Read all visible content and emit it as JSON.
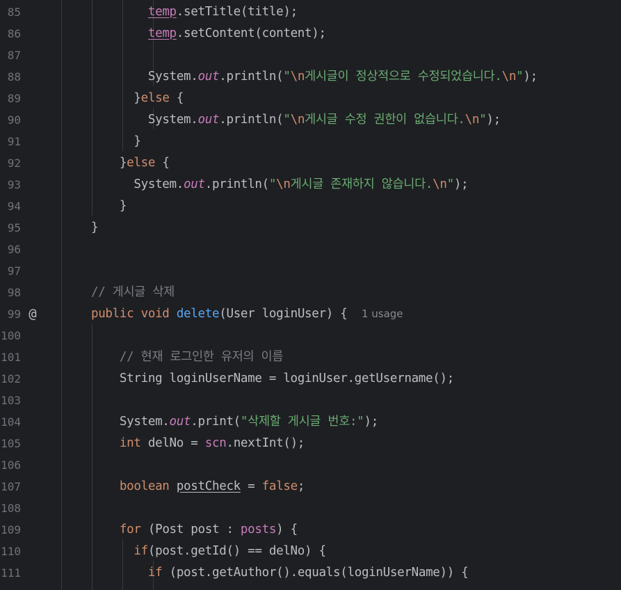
{
  "editor": {
    "hint_usage": "1 usage",
    "gutter_icon": "@",
    "colors": {
      "background": "#1e1f22",
      "keyword": "#cf8e6d",
      "string": "#6aab73",
      "method": "#56a8f5",
      "field": "#c77dbb",
      "comment": "#7a7e85",
      "text": "#bcbec4"
    },
    "lines": [
      {
        "num": "85"
      },
      {
        "num": "86"
      },
      {
        "num": "87"
      },
      {
        "num": "88"
      },
      {
        "num": "89"
      },
      {
        "num": "90"
      },
      {
        "num": "91"
      },
      {
        "num": "92"
      },
      {
        "num": "93"
      },
      {
        "num": "94"
      },
      {
        "num": "95"
      },
      {
        "num": "96"
      },
      {
        "num": "97"
      },
      {
        "num": "98"
      },
      {
        "num": "99"
      },
      {
        "num": "100"
      },
      {
        "num": "101"
      },
      {
        "num": "102"
      },
      {
        "num": "103"
      },
      {
        "num": "104"
      },
      {
        "num": "105"
      },
      {
        "num": "106"
      },
      {
        "num": "107"
      },
      {
        "num": "108"
      },
      {
        "num": "109"
      },
      {
        "num": "110"
      },
      {
        "num": "111"
      }
    ],
    "tokens": {
      "temp": "temp",
      "setTitle": ".setTitle(title);",
      "setContent": ".setContent(content);",
      "system": "System.",
      "out": "out",
      "println_open": ".println(",
      "print_open": ".print(",
      "quote": "\"",
      "newline": "\\n",
      "close_paren_semi": ");",
      "msg_edit_success": "게시글이 정상적으로 수정되었습니다.",
      "msg_no_permission": "게시글 수정 권한이 없습니다.",
      "msg_not_exist": "게시글 존재하지 않습니다.",
      "msg_delete_prompt": "\"삭제할 게시글 번호:\"",
      "close_brace": "}",
      "else_kw": "else",
      "open_brace": " {",
      "comment_delete": "// 게시글 삭제",
      "public_void": "public void ",
      "delete_fn": "delete",
      "delete_params": "(User loginUser) {",
      "comment_username": "// 현재 로그인한 유저의 이름",
      "string_decl": "String loginUserName = loginUser.getUsername();",
      "int_kw": "int",
      "delno_assign": " delNo = ",
      "scn": "scn",
      "nextInt": ".nextInt();",
      "boolean_kw": "boolean",
      "postCheck": "postCheck",
      "assign": " = ",
      "false_kw": "false",
      "semi": ";",
      "for_kw": "for",
      "for_head": " (Post post : ",
      "posts": "posts",
      "for_tail": ") {",
      "if_kw": "if",
      "if_getid": "(post.getId() == delNo) {",
      "if_space": " ",
      "if_author": "(post.getAuthor().equals(loginUserName)) {"
    }
  }
}
